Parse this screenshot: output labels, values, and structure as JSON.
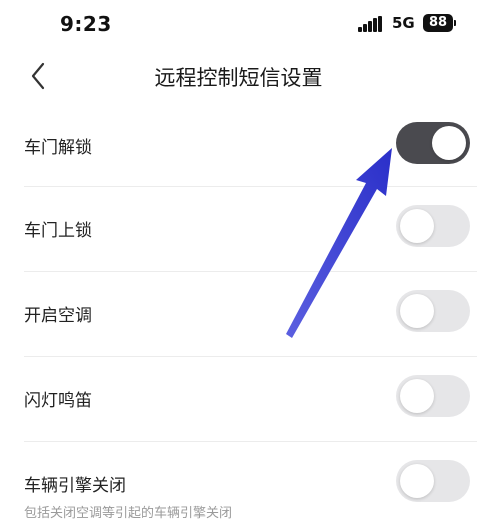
{
  "status_bar": {
    "time": "9:23",
    "network": "5G",
    "battery": "88"
  },
  "nav": {
    "title": "远程控制短信设置",
    "back_icon": "chevron-left-icon"
  },
  "settings": [
    {
      "label": "车门解锁",
      "enabled": true
    },
    {
      "label": "车门上锁",
      "enabled": false
    },
    {
      "label": "开启空调",
      "enabled": false
    },
    {
      "label": "闪灯鸣笛",
      "enabled": false
    },
    {
      "label": "车辆引擎关闭",
      "enabled": false,
      "description": "包括关闭空调等引起的车辆引擎关闭"
    }
  ],
  "colors": {
    "toggle_on": "#4a4a4f",
    "toggle_off": "#e6e6e8",
    "annotation_arrow": "#3a3fd6"
  }
}
